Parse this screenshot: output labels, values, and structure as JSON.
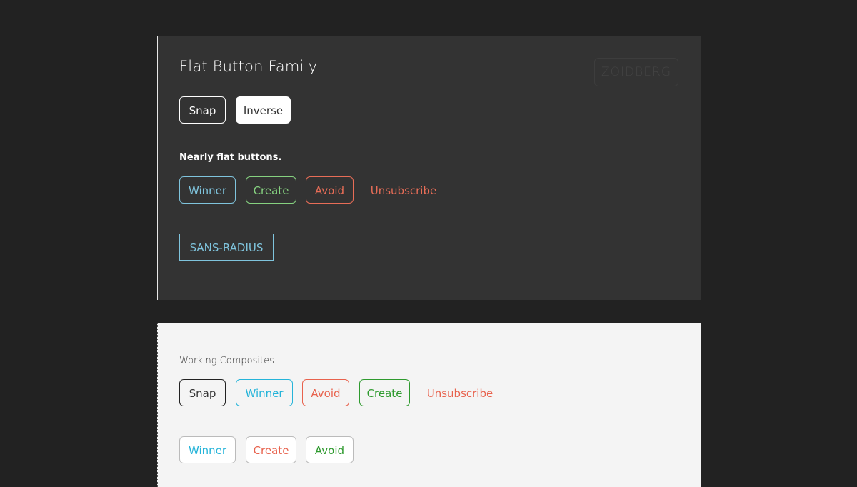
{
  "dark_panel": {
    "title": "Flat Button Family",
    "badge": "ZOIDBERG",
    "primary_buttons": {
      "snap": "Snap",
      "inverse": "Inverse"
    },
    "nearly_flat_label": "Nearly flat buttons.",
    "nearly_flat_buttons": {
      "winner": "Winner",
      "create": "Create",
      "avoid": "Avoid",
      "unsubscribe": "Unsubscribe"
    },
    "sans_radius": "SANS-RADIUS"
  },
  "light_panel": {
    "label": "Working Composites.",
    "row1": {
      "snap": "Snap",
      "winner": "Winner",
      "avoid": "Avoid",
      "create": "Create",
      "unsubscribe": "Unsubscribe"
    },
    "row2": {
      "winner": "Winner",
      "create": "Create",
      "avoid": "Avoid"
    }
  },
  "colors": {
    "page_background": "#222222",
    "dark_panel": "#333333",
    "light_panel": "#f4f4f4",
    "winner_dark": "#7fc4dd",
    "create_dark": "#86d280",
    "avoid_dark": "#e86d57",
    "winner_light": "#25b4d9",
    "create_light": "#2e9a2e",
    "avoid_light": "#e8624d"
  }
}
